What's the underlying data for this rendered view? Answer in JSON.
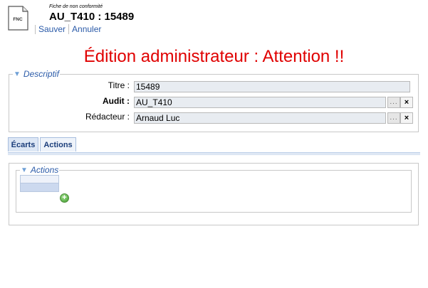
{
  "header": {
    "doc_icon_label": "FNC",
    "subtitle": "Fiche de non conformité",
    "title": "AU_T410 : 15489"
  },
  "toolbar": {
    "save_label": "Sauver",
    "cancel_label": "Annuler"
  },
  "warning_text": "Édition administrateur : Attention !!",
  "descriptif": {
    "legend": "Descriptif",
    "fields": {
      "titre": {
        "label": "Titre :",
        "value": "15489"
      },
      "audit": {
        "label": "Audit :",
        "value": "AU_T410",
        "dots": "...",
        "clear": "×"
      },
      "redacteur": {
        "label": "Rédacteur :",
        "value": "Arnaud Luc",
        "dots": "...",
        "clear": "×"
      }
    }
  },
  "tabs": [
    {
      "label": "Écarts",
      "active": true
    },
    {
      "label": "Actions",
      "active": false
    }
  ],
  "actions_panel": {
    "legend": "Actions",
    "add_symbol": "+"
  },
  "colors": {
    "warning": "#e00000",
    "link": "#2a5aa8",
    "legend": "#2a5aa8",
    "input_bg": "#e8ecf1",
    "tab_border": "#a8bede"
  }
}
